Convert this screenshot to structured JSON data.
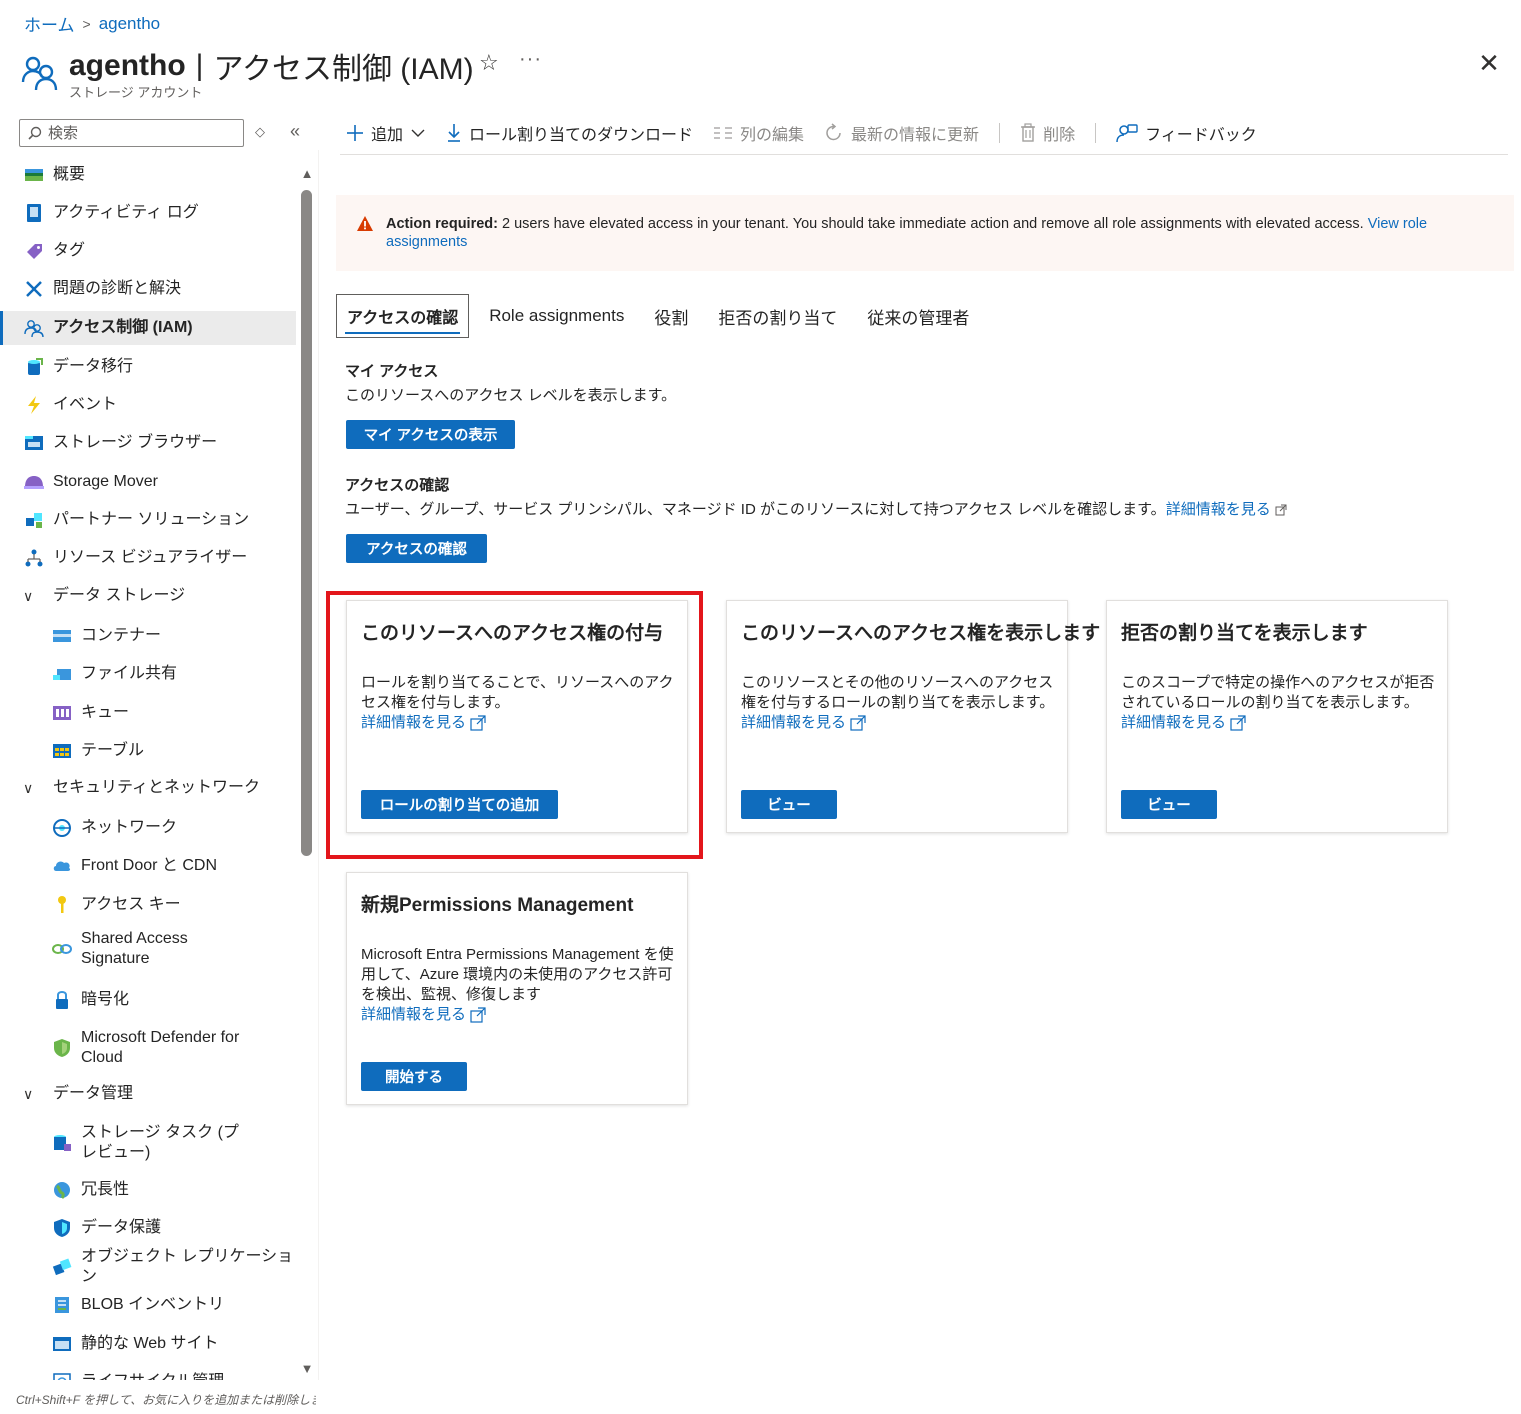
{
  "breadcrumb": {
    "home": "ホーム",
    "resource": "agentho"
  },
  "header": {
    "name": "agentho",
    "separator": "|",
    "page": "アクセス制御 (IAM)",
    "subtitle": "ストレージ アカウント",
    "star_icon": "star-icon",
    "more_icon": "ellipsis-icon",
    "close_icon": "close-icon"
  },
  "sidebar": {
    "search_placeholder": "検索",
    "items": [
      {
        "label": "概要",
        "icon": "overview-icon"
      },
      {
        "label": "アクティビティ ログ",
        "icon": "activity-log-icon"
      },
      {
        "label": "タグ",
        "icon": "tag-icon"
      },
      {
        "label": "問題の診断と解決",
        "icon": "wrench-icon"
      },
      {
        "label": "アクセス制御 (IAM)",
        "icon": "people-icon",
        "selected": true
      },
      {
        "label": "データ移行",
        "icon": "data-migration-icon"
      },
      {
        "label": "イベント",
        "icon": "lightning-icon"
      },
      {
        "label": "ストレージ ブラウザー",
        "icon": "storage-browser-icon"
      },
      {
        "label": "Storage Mover",
        "icon": "storage-mover-icon"
      },
      {
        "label": "パートナー ソリューション",
        "icon": "partner-icon"
      },
      {
        "label": "リソース ビジュアライザー",
        "icon": "visualizer-icon"
      }
    ],
    "groups": [
      {
        "label": "データ ストレージ",
        "items": [
          {
            "label": "コンテナー",
            "icon": "container-icon"
          },
          {
            "label": "ファイル共有",
            "icon": "file-share-icon"
          },
          {
            "label": "キュー",
            "icon": "queue-icon"
          },
          {
            "label": "テーブル",
            "icon": "table-icon"
          }
        ]
      },
      {
        "label": "セキュリティとネットワーク",
        "items": [
          {
            "label": "ネットワーク",
            "icon": "network-icon"
          },
          {
            "label": "Front Door と CDN",
            "icon": "cdn-icon"
          },
          {
            "label": "アクセス キー",
            "icon": "key-icon"
          },
          {
            "label": "Shared Access Signature",
            "icon": "link-icon"
          },
          {
            "label": "暗号化",
            "icon": "lock-icon"
          },
          {
            "label": "Microsoft Defender for Cloud",
            "icon": "shield-icon"
          }
        ]
      },
      {
        "label": "データ管理",
        "items": [
          {
            "label": "ストレージ タスク (プレビュー)",
            "icon": "storage-tasks-icon"
          },
          {
            "label": "冗長性",
            "icon": "globe-icon"
          },
          {
            "label": "データ保護",
            "icon": "data-protection-icon"
          },
          {
            "label": "オブジェクト レプリケーション",
            "icon": "replication-icon"
          },
          {
            "label": "BLOB インベントリ",
            "icon": "inventory-icon"
          },
          {
            "label": "静的な Web サイト",
            "icon": "website-icon"
          },
          {
            "label": "ライフサイクル管理",
            "icon": "lifecycle-icon"
          }
        ]
      }
    ],
    "footer_hint": "Ctrl+Shift+F を押して、お気に入りを追加または削除しま"
  },
  "toolbar": {
    "add": "追加",
    "download": "ロール割り当てのダウンロード",
    "edit_columns": "列の編集",
    "refresh": "最新の情報に更新",
    "delete": "削除",
    "feedback": "フィードバック"
  },
  "banner": {
    "bold": "Action required:",
    "text": " 2 users have elevated access in your tenant. You should take immediate action and remove all role assignments with elevated access. ",
    "link": "View role assignments",
    "color": "#fdf6f3"
  },
  "tabs": [
    "アクセスの確認",
    "Role assignments",
    "役割",
    "拒否の割り当て",
    "従来の管理者"
  ],
  "my_access": {
    "title": "マイ アクセス",
    "desc": "このリソースへのアクセス レベルを表示します。",
    "button": "マイ アクセスの表示"
  },
  "check_access": {
    "title": "アクセスの確認",
    "desc": "ユーザー、グループ、サービス プリンシパル、マネージド ID がこのリソースに対して持つアクセス レベルを確認します。",
    "link": "詳細情報を見る",
    "button": "アクセスの確認"
  },
  "cards": [
    {
      "title": "このリソースへのアクセス権の付与",
      "desc": "ロールを割り当てることで、リソースへのアクセス権を付与します。",
      "link": "詳細情報を見る",
      "button": "ロールの割り当ての追加"
    },
    {
      "title": "このリソースへのアクセス権を表示します",
      "desc": "このリソースとその他のリソースへのアクセス権を付与するロールの割り当てを表示します。",
      "link": "詳細情報を見る",
      "button": "ビュー"
    },
    {
      "title": "拒否の割り当てを表示します",
      "desc": "このスコープで特定の操作へのアクセスが拒否されているロールの割り当てを表示します。",
      "link": "詳細情報を見る",
      "button": "ビュー"
    },
    {
      "title": "新規Permissions Management",
      "desc": "Microsoft Entra Permissions Management を使用して、Azure 環境内の未使用のアクセス許可を検出、監視、修復します",
      "link": "詳細情報を見る",
      "button": "開始する"
    }
  ],
  "colors": {
    "accent": "#0f6cbd",
    "highlight": "#e3161b",
    "warning": "#d83b01"
  }
}
